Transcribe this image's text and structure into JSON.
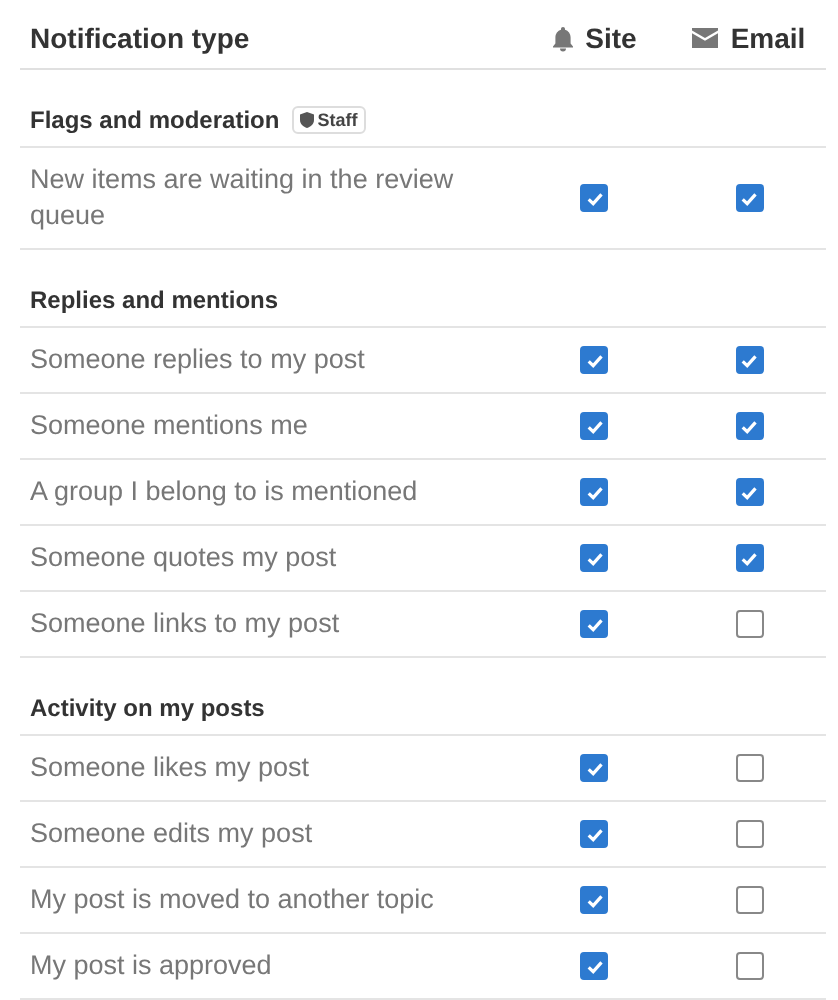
{
  "header": {
    "type_label": "Notification type",
    "site_label": "Site",
    "email_label": "Email"
  },
  "sections": [
    {
      "title": "Flags and moderation",
      "badge": "Staff",
      "rows": [
        {
          "label": "New items are waiting in the review queue",
          "site": true,
          "email": true
        }
      ]
    },
    {
      "title": "Replies and mentions",
      "rows": [
        {
          "label": "Someone replies to my post",
          "site": true,
          "email": true
        },
        {
          "label": "Someone mentions me",
          "site": true,
          "email": true
        },
        {
          "label": "A group I belong to is mentioned",
          "site": true,
          "email": true
        },
        {
          "label": "Someone quotes my post",
          "site": true,
          "email": true
        },
        {
          "label": "Someone links to my post",
          "site": true,
          "email": false
        }
      ]
    },
    {
      "title": "Activity on my posts",
      "rows": [
        {
          "label": "Someone likes my post",
          "site": true,
          "email": false
        },
        {
          "label": "Someone edits my post",
          "site": true,
          "email": false
        },
        {
          "label": "My post is moved to another topic",
          "site": true,
          "email": false
        },
        {
          "label": "My post is approved",
          "site": true,
          "email": false
        }
      ]
    }
  ]
}
